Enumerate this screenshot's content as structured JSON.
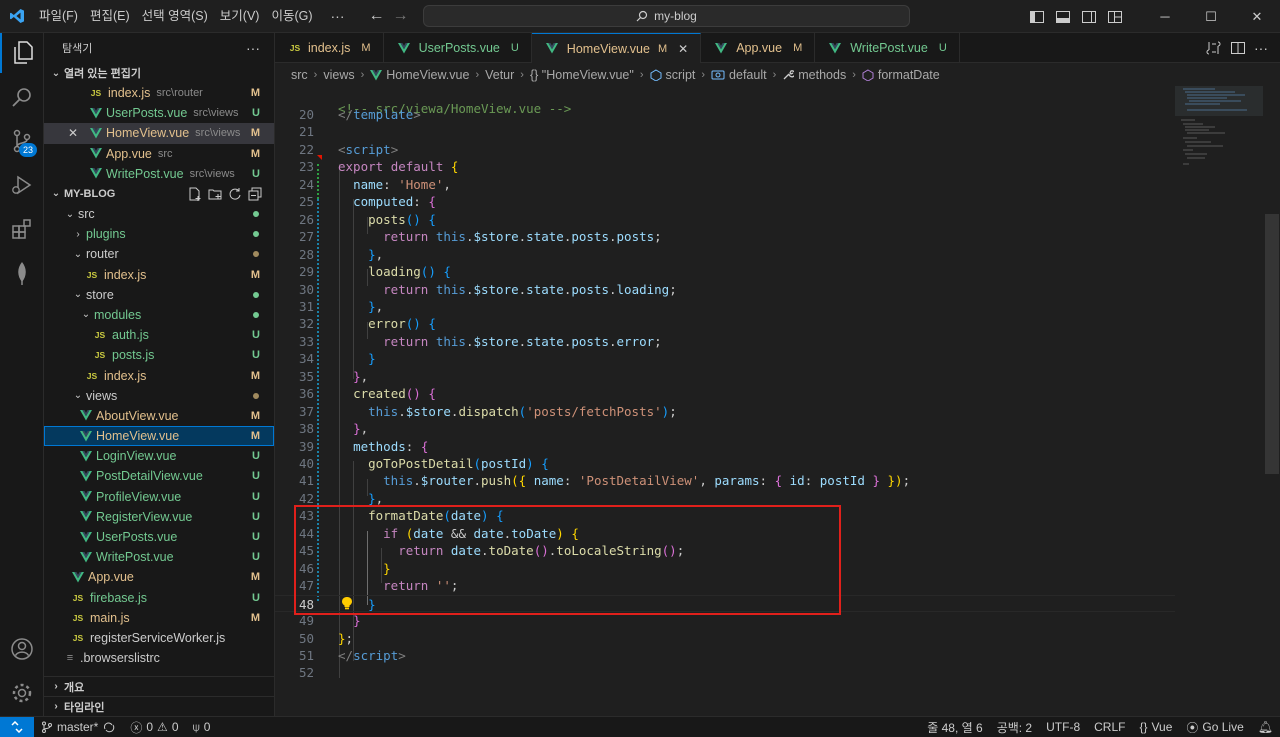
{
  "titlebar": {
    "menus": [
      "파일(F)",
      "편집(E)",
      "선택 영역(S)",
      "보기(V)",
      "이동(G)"
    ],
    "more": "···",
    "search": "my-blog"
  },
  "activity": {
    "scm_badge": "23"
  },
  "sidebar": {
    "title": "탐색기",
    "more": "···",
    "open_editors_title": "열려 있는 편집기",
    "open_editors": [
      {
        "name": "index.js",
        "desc": "src\\router",
        "status": "M",
        "type": "js"
      },
      {
        "name": "UserPosts.vue",
        "desc": "src\\views",
        "status": "U",
        "type": "vue"
      },
      {
        "name": "HomeView.vue",
        "desc": "src\\views",
        "status": "M",
        "type": "vue"
      },
      {
        "name": "App.vue",
        "desc": "src",
        "status": "M",
        "type": "vue"
      },
      {
        "name": "WritePost.vue",
        "desc": "src\\views",
        "status": "U",
        "type": "vue"
      }
    ],
    "project_title": "MY-BLOG",
    "tree": [
      {
        "name": "src",
        "kind": "folder-open"
      },
      {
        "name": "plugins",
        "kind": "folder"
      },
      {
        "name": "router",
        "kind": "folder-open"
      },
      {
        "name": "index.js",
        "status": "M"
      },
      {
        "name": "store",
        "kind": "folder-open"
      },
      {
        "name": "modules",
        "kind": "folder-open"
      },
      {
        "name": "auth.js",
        "status": "U"
      },
      {
        "name": "posts.js",
        "status": "U"
      },
      {
        "name": "index.js",
        "status": "M"
      },
      {
        "name": "views",
        "kind": "folder-open"
      },
      {
        "name": "AboutView.vue",
        "status": "M"
      },
      {
        "name": "HomeView.vue",
        "status": "M"
      },
      {
        "name": "LoginView.vue",
        "status": "U"
      },
      {
        "name": "PostDetailView.vue",
        "status": "U"
      },
      {
        "name": "ProfileView.vue",
        "status": "U"
      },
      {
        "name": "RegisterView.vue",
        "status": "U"
      },
      {
        "name": "UserPosts.vue",
        "status": "U"
      },
      {
        "name": "WritePost.vue",
        "status": "U"
      },
      {
        "name": "App.vue",
        "status": "M"
      },
      {
        "name": "firebase.js",
        "status": "U"
      },
      {
        "name": "main.js",
        "status": "M"
      },
      {
        "name": "registerServiceWorker.js"
      },
      {
        "name": ".browserslistrc"
      }
    ],
    "outline_title": "개요",
    "timeline_title": "타임라인"
  },
  "tabs": [
    {
      "name": "index.js",
      "status": "M",
      "type": "js"
    },
    {
      "name": "UserPosts.vue",
      "status": "U",
      "type": "vue"
    },
    {
      "name": "HomeView.vue",
      "status": "M",
      "type": "vue",
      "active": true
    },
    {
      "name": "App.vue",
      "status": "M",
      "type": "vue"
    },
    {
      "name": "WritePost.vue",
      "status": "U",
      "type": "vue"
    }
  ],
  "breadcrumbs": [
    "src",
    "views",
    "HomeView.vue",
    "Vetur",
    "{} \"HomeView.vue\"",
    "script",
    "default",
    "methods",
    "formatDate"
  ],
  "editor": {
    "line_numbers": [
      "20",
      "21",
      "22",
      "23",
      "24",
      "25",
      "26",
      "27",
      "28",
      "29",
      "30",
      "31",
      "32",
      "33",
      "34",
      "35",
      "36",
      "37",
      "38",
      "39",
      "40",
      "41",
      "42",
      "43",
      "44",
      "45",
      "46",
      "47",
      "48",
      "49",
      "50",
      "51",
      "52"
    ],
    "sticky_line": "<!-- src/viewa/HomeView.vue -->"
  },
  "statusbar": {
    "branch": "master*",
    "errors": "0",
    "warnings": "0",
    "ports": "0",
    "position": "줄 48, 열 6",
    "spaces": "공백: 2",
    "encoding": "UTF-8",
    "eol": "CRLF",
    "language": "Vue",
    "golive": "Go Live"
  }
}
